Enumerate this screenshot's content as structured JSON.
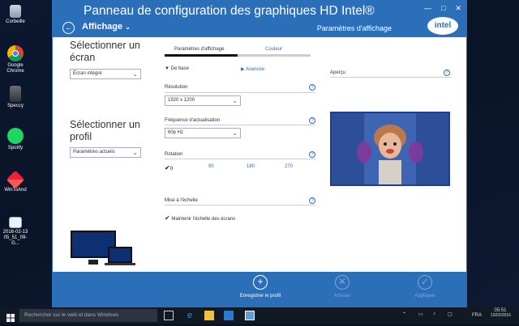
{
  "desktop": {
    "icons": [
      {
        "label": "Corbeille",
        "icon": "recycle-bin-icon"
      },
      {
        "label": "Google Chrome",
        "icon": "chrome-icon"
      },
      {
        "label": "Speccy",
        "icon": "speccy-icon"
      },
      {
        "label": "Spotify",
        "icon": "spotify-icon"
      },
      {
        "label": "WinToAnd",
        "icon": "wintoand-icon"
      },
      {
        "label": "2016-02-13 05_51_09-G...",
        "icon": "image-file-icon"
      }
    ]
  },
  "window": {
    "title": "Panneau de configuration des graphiques HD Intel®",
    "menu_label": "Affichage",
    "section_title": "Paramètres d'affichage",
    "logo_text": "intel",
    "controls": {
      "minimize": "—",
      "maximize": "□",
      "close": "✕"
    }
  },
  "left": {
    "screen_heading": "Sélectionner un écran",
    "screen_value": "Écran intégré",
    "profile_heading": "Sélectionner un profil",
    "profile_value": "Paramètres actuels"
  },
  "tabs": [
    {
      "label": "Paramètres d'affichage",
      "active": true
    },
    {
      "label": "Couleur",
      "active": false
    }
  ],
  "mode": {
    "basic": "De base",
    "advanced": "Avancée"
  },
  "settings": {
    "resolution_label": "Résolution",
    "resolution_value": "1920 x 1200",
    "refresh_label": "Fréquence d'actualisation",
    "refresh_value": "60p Hz",
    "rotation_label": "Rotation",
    "rotation_options": [
      "0",
      "90",
      "180",
      "270"
    ],
    "scaling_label": "Mise à l'échelle",
    "scaling_option": "Maintenir l'échelle des écrans"
  },
  "preview_label": "Aperçu",
  "actions": {
    "save": "Enregistrer le profil",
    "cancel": "Annuler",
    "apply": "Appliquer"
  },
  "taskbar": {
    "search_placeholder": "Rechercher sur le web et dans Windows",
    "language": "FRA",
    "time": "05:51",
    "date": "13/02/2016"
  },
  "colors": {
    "accent": "#2b6fb8",
    "taskbar": "#111a24"
  }
}
